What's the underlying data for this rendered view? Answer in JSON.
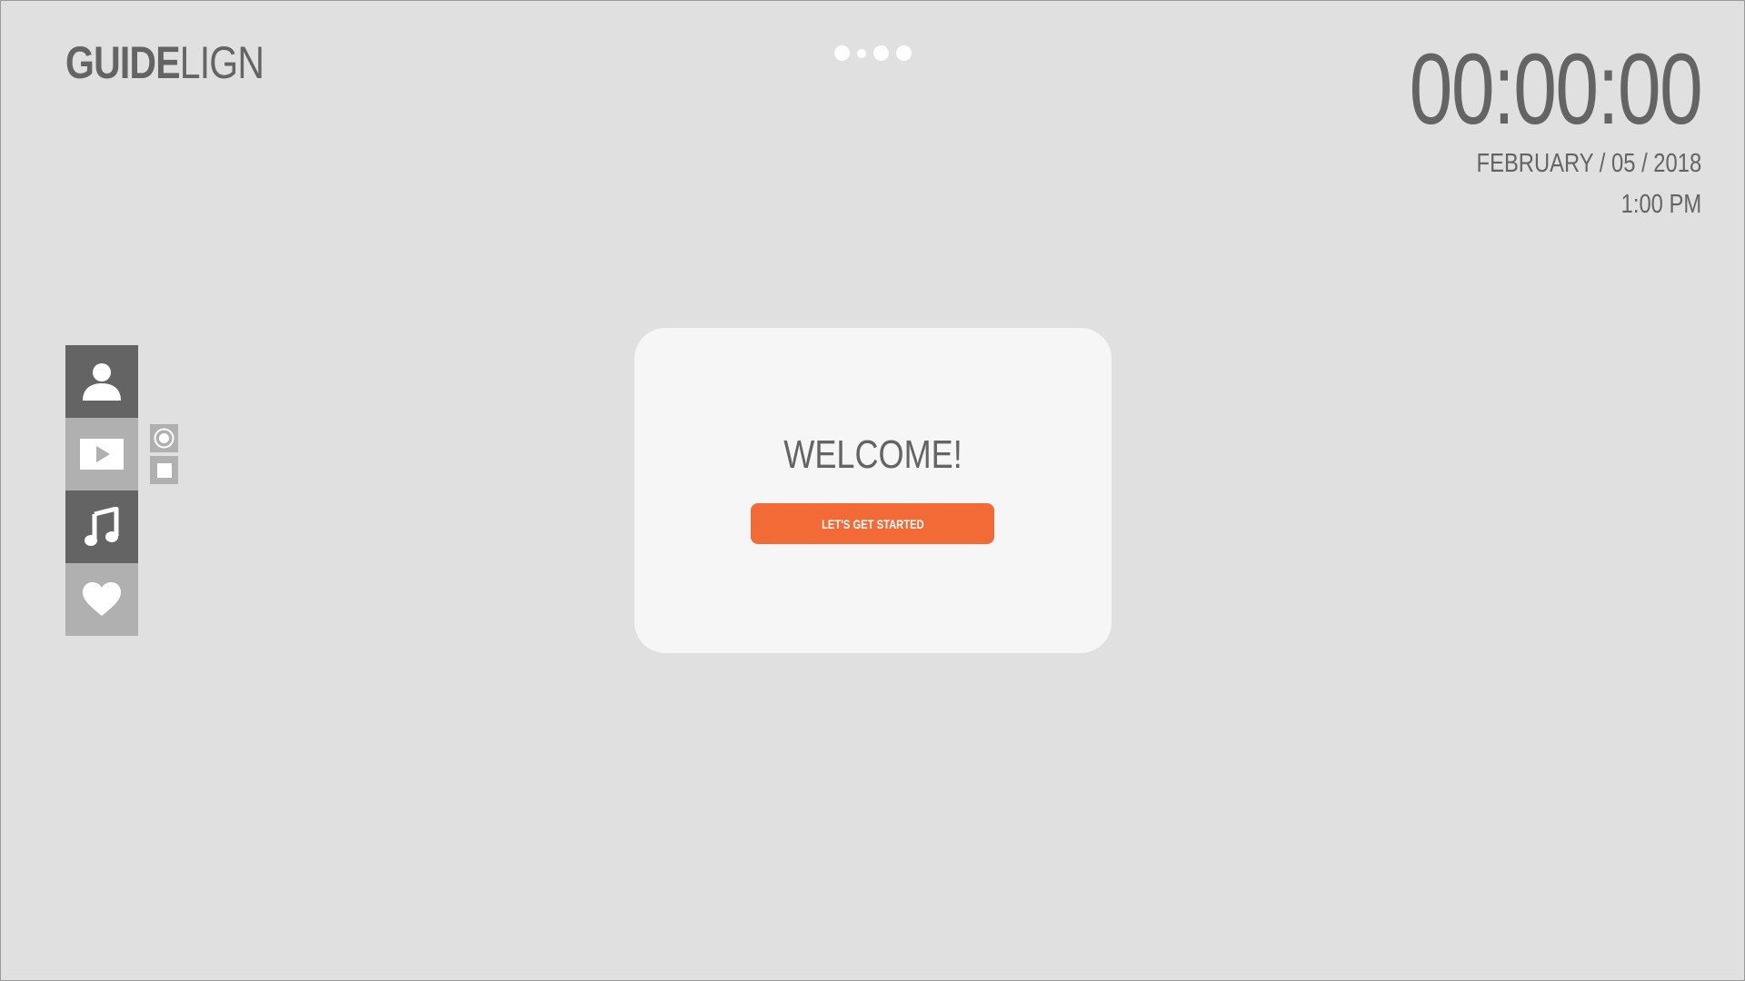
{
  "app": {
    "logo_bold": "GUIDE",
    "logo_light": "LIGN"
  },
  "pager": {
    "pages": 4,
    "active_index": 1
  },
  "clock": {
    "time": "00:00:00",
    "date": "FEBRUARY / 05 / 2018",
    "hour": "1:00 PM"
  },
  "sidebar": {
    "items": [
      {
        "icon": "user-icon",
        "state": "dark"
      },
      {
        "icon": "play-icon",
        "state": "light"
      },
      {
        "icon": "music-note-icon",
        "state": "dark"
      },
      {
        "icon": "heart-icon",
        "state": "light"
      }
    ],
    "mini_controls": [
      {
        "icon": "record-icon"
      },
      {
        "icon": "stop-icon"
      }
    ]
  },
  "welcome": {
    "title": "WELCOME!",
    "button_label": "LET'S GET STARTED"
  },
  "colors": {
    "background": "#e0e0e0",
    "text": "#646464",
    "card": "#f7f6f6",
    "accent": "#f26a36",
    "sidebar_dark": "#646464",
    "sidebar_light": "#b0b0b0"
  }
}
